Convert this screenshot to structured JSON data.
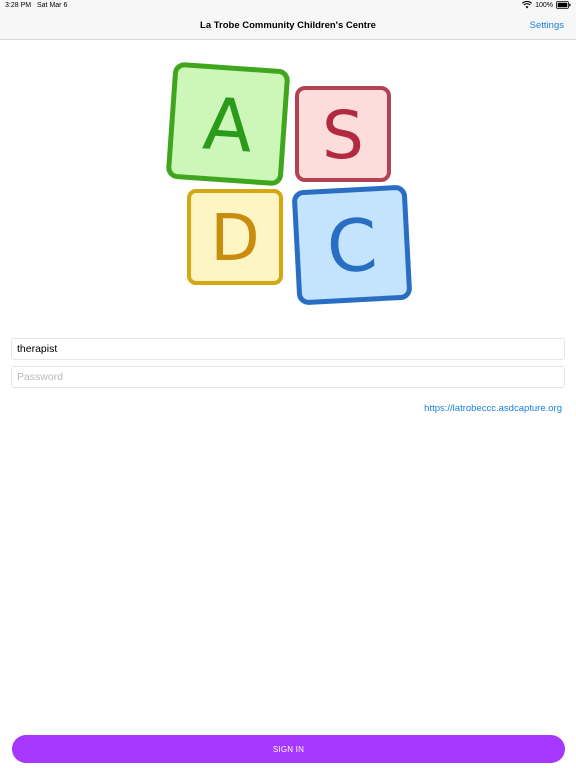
{
  "status_bar": {
    "time": "3:28 PM",
    "date": "Sat Mar 6",
    "battery": "100%"
  },
  "nav": {
    "title": "La Trobe Community Children's Centre",
    "settings_label": "Settings"
  },
  "logo": {
    "letters": [
      "A",
      "S",
      "D",
      "C"
    ],
    "colors": {
      "a_fill": "#ccf7b8",
      "a_stroke": "#3fa61d",
      "a_text": "#2a9a1a",
      "s_fill": "#fddcdc",
      "s_stroke": "#b34252",
      "s_text": "#b22a42",
      "d_fill": "#fef5c4",
      "d_stroke": "#d5a712",
      "d_text": "#c98c0c",
      "c_fill": "#c4e4fd",
      "c_stroke": "#2a6ec4",
      "c_text": "#2a6ec4"
    }
  },
  "form": {
    "username_value": "therapist",
    "password_placeholder": "Password",
    "server_url": "https://latrobeccc.asdcapture.org",
    "signin_label": "SIGN IN"
  },
  "colors": {
    "accent": "#a537ff",
    "link": "#1a7fe0"
  }
}
